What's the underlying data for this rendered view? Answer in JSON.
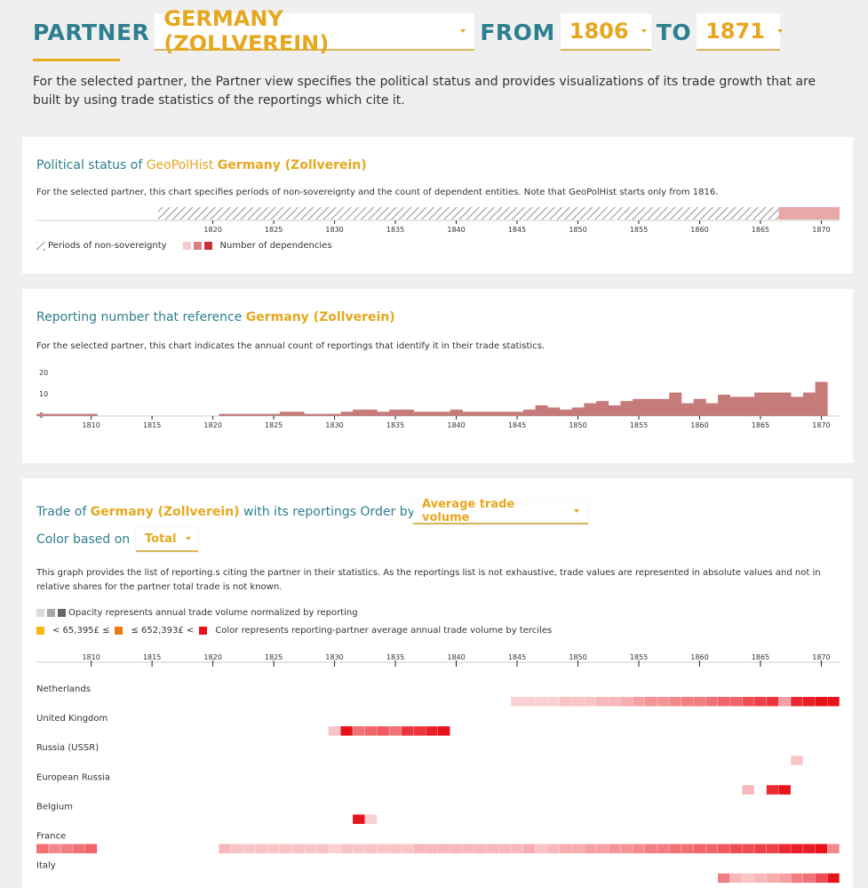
{
  "header": {
    "partner_label": "PARTNER",
    "partner_value": "GERMANY (ZOLLVEREIN)",
    "from_label": "FROM",
    "from_value": "1806",
    "to_label": "TO",
    "to_value": "1871",
    "intro": "For the selected partner, the Partner view specifies the political status and provides visualizations of its trade growth that are built by using trade statistics of the reportings which cite it."
  },
  "panel1": {
    "title_prefix": "Political status of ",
    "title_source": "GeoPolHist",
    "title_partner": "Germany (Zollverein)",
    "description": "For the selected partner, this chart specifies periods of non-sovereignty and the count of dependent entities. Note that GeoPolHist starts only from 1816.",
    "legend_nonsov": "Periods of non-sovereignty",
    "legend_dependencies": "Number of dependencies"
  },
  "panel2": {
    "title_prefix": "Reporting number that reference ",
    "title_partner": "Germany (Zollverein)",
    "description": "For the selected partner, this chart indicates the annual count of reportings that identify it in their trade statistics."
  },
  "panel3": {
    "title_prefix": "Trade of ",
    "title_partner": "Germany (Zollverein)",
    "title_suffix": " with its reportings Order by",
    "order_value": "Average trade volume",
    "color_label": "Color based on",
    "color_value": "Total",
    "description": "This graph provides the list of reporting.s citing the partner in their statistics. As the reportings list is not exhaustive, trade values are represented in absolute values and not in relative shares for the partner total trade is not known.",
    "legend_opacity": "Opacity represents annual trade volume normalized by reporting",
    "legend_t1": "< 65,395£ ≤",
    "legend_t2": "≤ 652,393£ <",
    "legend_color": "Color represents reporting-partner average annual trade volume by terciles"
  },
  "colors": {
    "accent": "#e6a71e",
    "teal": "#2d7f8f",
    "bar": "#c77a7a",
    "red": "#e8121b",
    "orange": "#f07a12",
    "yellow": "#f5b80c",
    "dep_light": "#e7a8aa"
  },
  "chart_data": [
    {
      "type": "timeline",
      "xlim": [
        1806,
        1871
      ],
      "xticks": [
        1820,
        1825,
        1830,
        1835,
        1840,
        1845,
        1850,
        1855,
        1860,
        1865,
        1870
      ],
      "non_sovereignty": [
        1816,
        1866
      ],
      "dependencies": [
        {
          "from": 1867,
          "to": 1871,
          "level": 1
        }
      ]
    },
    {
      "type": "bar",
      "xlim": [
        1806,
        1871
      ],
      "xticks": [
        1810,
        1815,
        1820,
        1825,
        1830,
        1835,
        1840,
        1845,
        1850,
        1855,
        1860,
        1865,
        1870
      ],
      "yticks": [
        0,
        10,
        20
      ],
      "ylim": [
        0,
        20
      ],
      "years": [
        1806,
        1807,
        1808,
        1809,
        1810,
        1811,
        1812,
        1813,
        1814,
        1815,
        1816,
        1817,
        1818,
        1819,
        1820,
        1821,
        1822,
        1823,
        1824,
        1825,
        1826,
        1827,
        1828,
        1829,
        1830,
        1831,
        1832,
        1833,
        1834,
        1835,
        1836,
        1837,
        1838,
        1839,
        1840,
        1841,
        1842,
        1843,
        1844,
        1845,
        1846,
        1847,
        1848,
        1849,
        1850,
        1851,
        1852,
        1853,
        1854,
        1855,
        1856,
        1857,
        1858,
        1859,
        1860,
        1861,
        1862,
        1863,
        1864,
        1865,
        1866,
        1867,
        1868,
        1869,
        1870,
        1871
      ],
      "values": [
        1,
        1,
        1,
        1,
        1,
        0,
        0,
        0,
        0,
        0,
        0,
        0,
        0,
        0,
        0,
        1,
        1,
        1,
        1,
        1,
        2,
        2,
        1,
        1,
        1,
        2,
        3,
        3,
        2,
        3,
        3,
        2,
        2,
        2,
        3,
        2,
        2,
        2,
        2,
        2,
        3,
        5,
        4,
        3,
        4,
        6,
        7,
        5,
        7,
        8,
        8,
        8,
        11,
        6,
        8,
        6,
        10,
        9,
        9,
        11,
        11,
        11,
        9,
        11,
        16,
        0
      ]
    },
    {
      "type": "heatmap",
      "xlim": [
        1806,
        1871
      ],
      "xticks": [
        1810,
        1815,
        1820,
        1825,
        1830,
        1835,
        1840,
        1845,
        1850,
        1855,
        1860,
        1865,
        1870
      ],
      "rows": [
        {
          "name": "Netherlands",
          "tercile": "high",
          "cells": [
            [
              1845,
              0.2
            ],
            [
              1846,
              0.2
            ],
            [
              1847,
              0.2
            ],
            [
              1848,
              0.2
            ],
            [
              1849,
              0.25
            ],
            [
              1850,
              0.25
            ],
            [
              1851,
              0.25
            ],
            [
              1852,
              0.3
            ],
            [
              1853,
              0.3
            ],
            [
              1854,
              0.35
            ],
            [
              1855,
              0.4
            ],
            [
              1856,
              0.45
            ],
            [
              1857,
              0.45
            ],
            [
              1858,
              0.5
            ],
            [
              1859,
              0.55
            ],
            [
              1860,
              0.55
            ],
            [
              1861,
              0.6
            ],
            [
              1862,
              0.65
            ],
            [
              1863,
              0.65
            ],
            [
              1864,
              0.75
            ],
            [
              1865,
              0.8
            ],
            [
              1866,
              0.85
            ],
            [
              1867,
              0.4
            ],
            [
              1868,
              0.9
            ],
            [
              1869,
              0.95
            ],
            [
              1870,
              1.0
            ],
            [
              1871,
              1.0
            ]
          ]
        },
        {
          "name": "United Kingdom",
          "tercile": "high",
          "cells": [
            [
              1830,
              0.25
            ],
            [
              1831,
              1.0
            ],
            [
              1832,
              0.6
            ],
            [
              1833,
              0.65
            ],
            [
              1834,
              0.7
            ],
            [
              1835,
              0.6
            ],
            [
              1836,
              0.85
            ],
            [
              1837,
              0.85
            ],
            [
              1838,
              0.95
            ],
            [
              1839,
              1.0
            ]
          ]
        },
        {
          "name": "Russia (USSR)",
          "tercile": "high",
          "cells": [
            [
              1868,
              0.25
            ]
          ]
        },
        {
          "name": "European Russia",
          "tercile": "high",
          "cells": [
            [
              1864,
              0.3
            ],
            [
              1866,
              0.9
            ],
            [
              1867,
              1.0
            ]
          ]
        },
        {
          "name": "Belgium",
          "tercile": "high",
          "cells": [
            [
              1832,
              1.0
            ],
            [
              1833,
              0.2
            ]
          ]
        },
        {
          "name": "France",
          "tercile": "high",
          "cells": [
            [
              1806,
              0.6
            ],
            [
              1807,
              0.5
            ],
            [
              1808,
              0.55
            ],
            [
              1809,
              0.6
            ],
            [
              1810,
              0.65
            ],
            [
              1821,
              0.3
            ],
            [
              1822,
              0.25
            ],
            [
              1823,
              0.25
            ],
            [
              1824,
              0.25
            ],
            [
              1825,
              0.25
            ],
            [
              1826,
              0.25
            ],
            [
              1827,
              0.25
            ],
            [
              1828,
              0.25
            ],
            [
              1829,
              0.25
            ],
            [
              1830,
              0.2
            ],
            [
              1831,
              0.25
            ],
            [
              1832,
              0.25
            ],
            [
              1833,
              0.25
            ],
            [
              1834,
              0.25
            ],
            [
              1835,
              0.25
            ],
            [
              1836,
              0.25
            ],
            [
              1837,
              0.3
            ],
            [
              1838,
              0.3
            ],
            [
              1839,
              0.3
            ],
            [
              1840,
              0.3
            ],
            [
              1841,
              0.3
            ],
            [
              1842,
              0.3
            ],
            [
              1843,
              0.3
            ],
            [
              1844,
              0.3
            ],
            [
              1845,
              0.3
            ],
            [
              1846,
              0.35
            ],
            [
              1847,
              0.25
            ],
            [
              1848,
              0.3
            ],
            [
              1849,
              0.35
            ],
            [
              1850,
              0.35
            ],
            [
              1851,
              0.4
            ],
            [
              1852,
              0.4
            ],
            [
              1853,
              0.45
            ],
            [
              1854,
              0.45
            ],
            [
              1855,
              0.5
            ],
            [
              1856,
              0.55
            ],
            [
              1857,
              0.55
            ],
            [
              1858,
              0.6
            ],
            [
              1859,
              0.6
            ],
            [
              1860,
              0.65
            ],
            [
              1861,
              0.65
            ],
            [
              1862,
              0.7
            ],
            [
              1863,
              0.75
            ],
            [
              1864,
              0.75
            ],
            [
              1865,
              0.8
            ],
            [
              1866,
              0.8
            ],
            [
              1867,
              0.9
            ],
            [
              1868,
              0.95
            ],
            [
              1869,
              0.95
            ],
            [
              1870,
              1.0
            ],
            [
              1871,
              0.5
            ]
          ]
        },
        {
          "name": "Italy",
          "tercile": "high",
          "cells": [
            [
              1862,
              0.55
            ],
            [
              1863,
              0.3
            ],
            [
              1864,
              0.25
            ],
            [
              1865,
              0.3
            ],
            [
              1866,
              0.35
            ],
            [
              1867,
              0.4
            ],
            [
              1868,
              0.55
            ],
            [
              1869,
              0.6
            ],
            [
              1870,
              0.75
            ],
            [
              1871,
              1.0
            ]
          ]
        }
      ]
    }
  ]
}
